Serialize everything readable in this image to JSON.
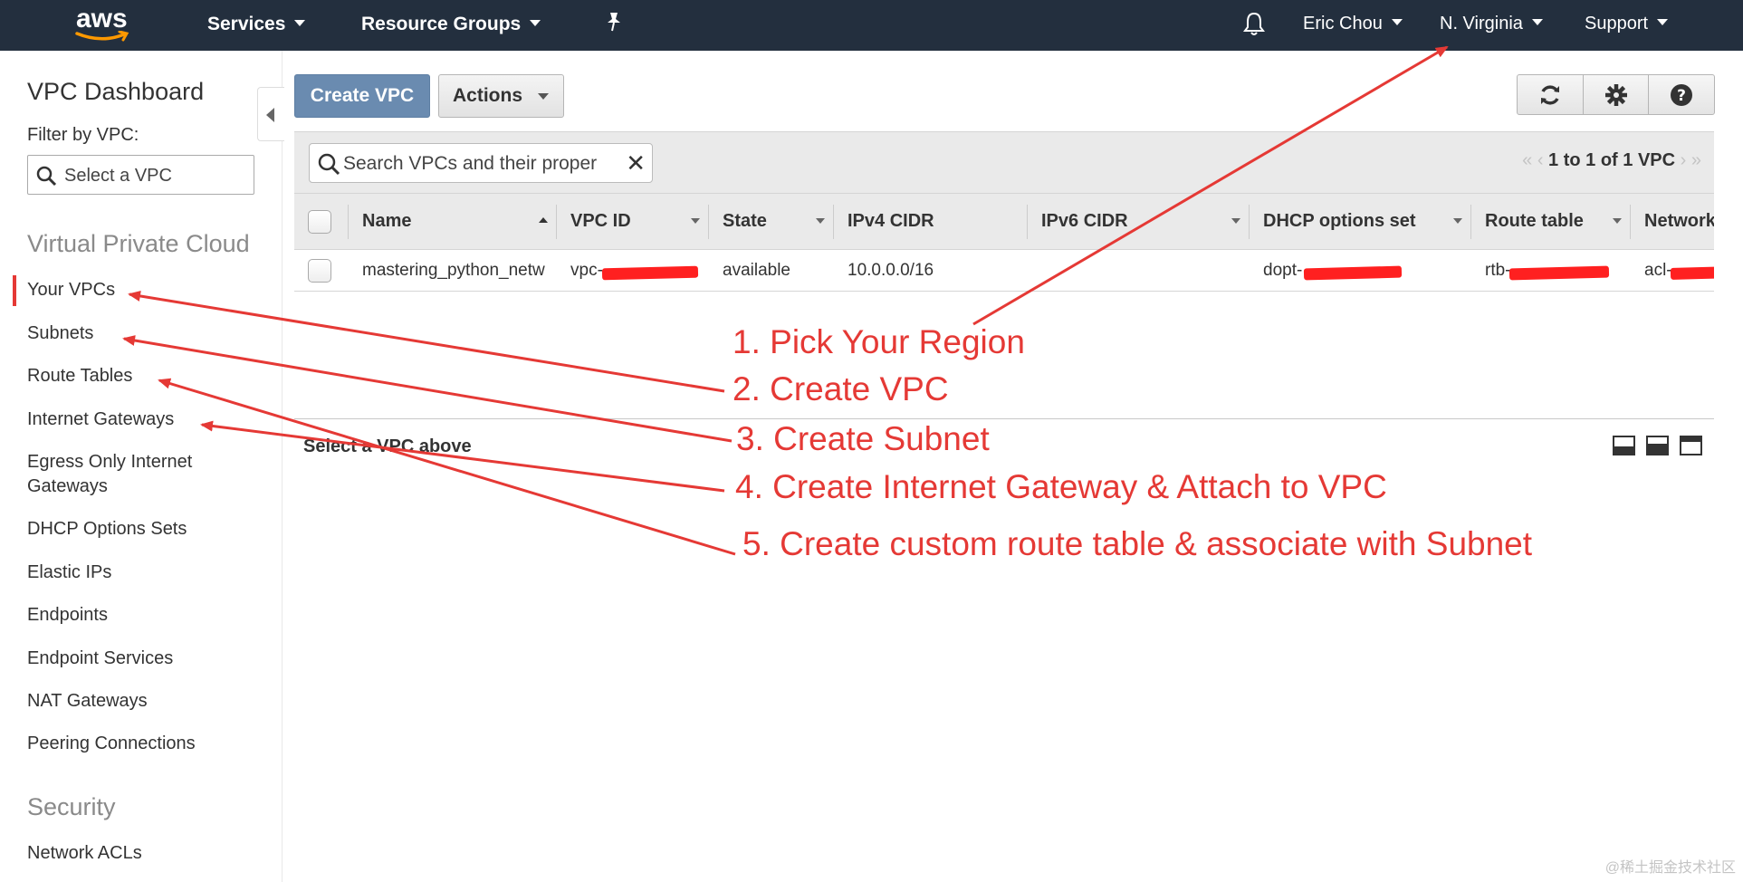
{
  "topnav": {
    "logo_text": "aws",
    "services": "Services",
    "resource_groups": "Resource Groups",
    "user": "Eric Chou",
    "region": "N. Virginia",
    "support": "Support"
  },
  "sidebar": {
    "title": "VPC Dashboard",
    "filter_label": "Filter by VPC:",
    "filter_placeholder": "Select a VPC",
    "section_vpc": "Virtual Private Cloud",
    "items": [
      "Your VPCs",
      "Subnets",
      "Route Tables",
      "Internet Gateways",
      "Egress Only Internet",
      "Gateways",
      "DHCP Options Sets",
      "Elastic IPs",
      "Endpoints",
      "Endpoint Services",
      "NAT Gateways",
      "Peering Connections"
    ],
    "section_security": "Security",
    "security_items": [
      "Network ACLs"
    ]
  },
  "toolbar": {
    "create_label": "Create VPC",
    "actions_label": "Actions",
    "search_placeholder": "Search VPCs and their proper",
    "pager_text": "1 to 1 of 1 VPC"
  },
  "table": {
    "headers": [
      "Name",
      "VPC ID",
      "State",
      "IPv4 CIDR",
      "IPv6 CIDR",
      "DHCP options set",
      "Route table",
      "Network"
    ],
    "rows": [
      [
        "mastering_python_netw",
        "vpc-",
        "available",
        "10.0.0.0/16",
        "",
        "dopt-",
        "rtb-",
        "acl-"
      ]
    ]
  },
  "lower": {
    "select_text": "Select a VPC above"
  },
  "annotations": [
    "1. Pick Your Region",
    "2. Create VPC",
    "3. Create Subnet",
    "4. Create Internet Gateway & Attach to VPC",
    "5. Create custom route table & associate with Subnet"
  ],
  "watermark": "@稀土掘金技术社区",
  "colors": {
    "nav_bg": "#232f3e",
    "primary_button": "#6a8bb0",
    "annotation_red": "#e53935"
  }
}
